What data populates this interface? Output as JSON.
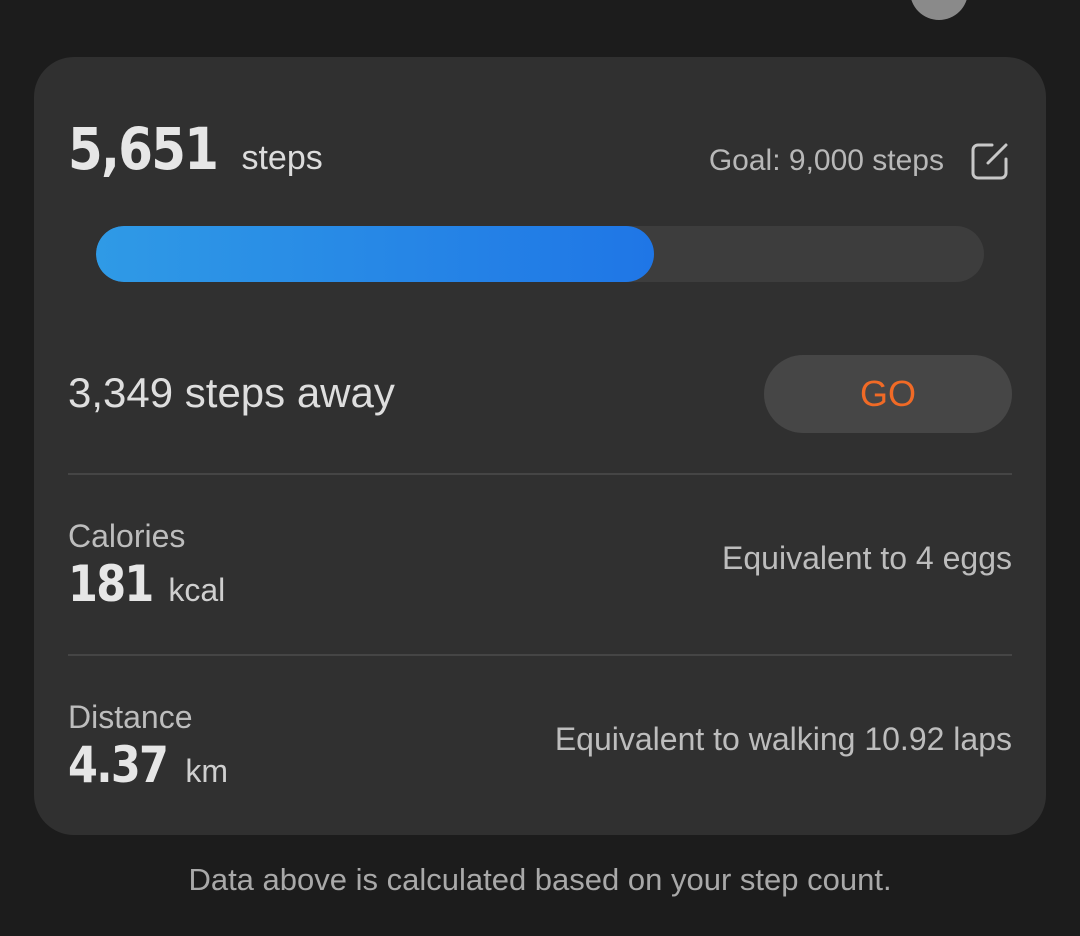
{
  "summary": {
    "steps_value": "5,651",
    "steps_unit": "steps",
    "goal_text": "Goal: 9,000 steps",
    "progress_fraction": 0.628
  },
  "remaining": {
    "text": "3,349 steps away",
    "go_label": "GO"
  },
  "calories": {
    "label": "Calories",
    "value": "181",
    "unit": "kcal",
    "equivalent": "Equivalent to 4 eggs"
  },
  "distance": {
    "label": "Distance",
    "value": "4.37",
    "unit": "km",
    "equivalent": "Equivalent to walking 10.92 laps"
  },
  "footer": {
    "note": "Data above is calculated based on your step count."
  },
  "icons": {
    "edit": "edit-goal-icon"
  },
  "colors": {
    "accent_go": "#f06a26",
    "progress_start": "#2f9ae6",
    "progress_end": "#1f76e6",
    "card_bg": "#303030",
    "page_bg": "#1c1c1c"
  }
}
